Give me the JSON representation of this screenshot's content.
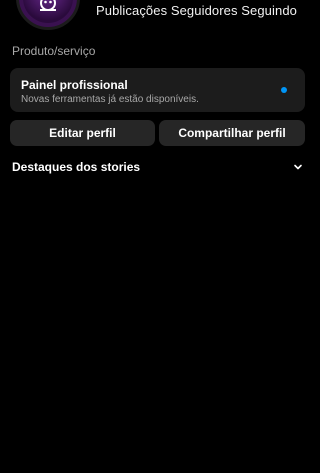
{
  "profile": {
    "avatar_icon": "robot-avatar-icon",
    "stats": [
      {
        "label": "Publicações"
      },
      {
        "label": "Seguidores"
      },
      {
        "label": "Seguindo"
      }
    ],
    "category": "Produto/serviço"
  },
  "pro_dashboard": {
    "title": "Painel profissional",
    "subtitle": "Novas ferramentas já estão disponíveis.",
    "dot_color": "#0095f6"
  },
  "actions": {
    "edit_label": "Editar perfil",
    "share_label": "Compartilhar perfil"
  },
  "highlights": {
    "label": "Destaques dos stories",
    "icon": "chevron-down-icon"
  },
  "colors": {
    "background": "#000000",
    "card": "#1c1c1c",
    "button": "#262626",
    "accent": "#0095f6"
  }
}
